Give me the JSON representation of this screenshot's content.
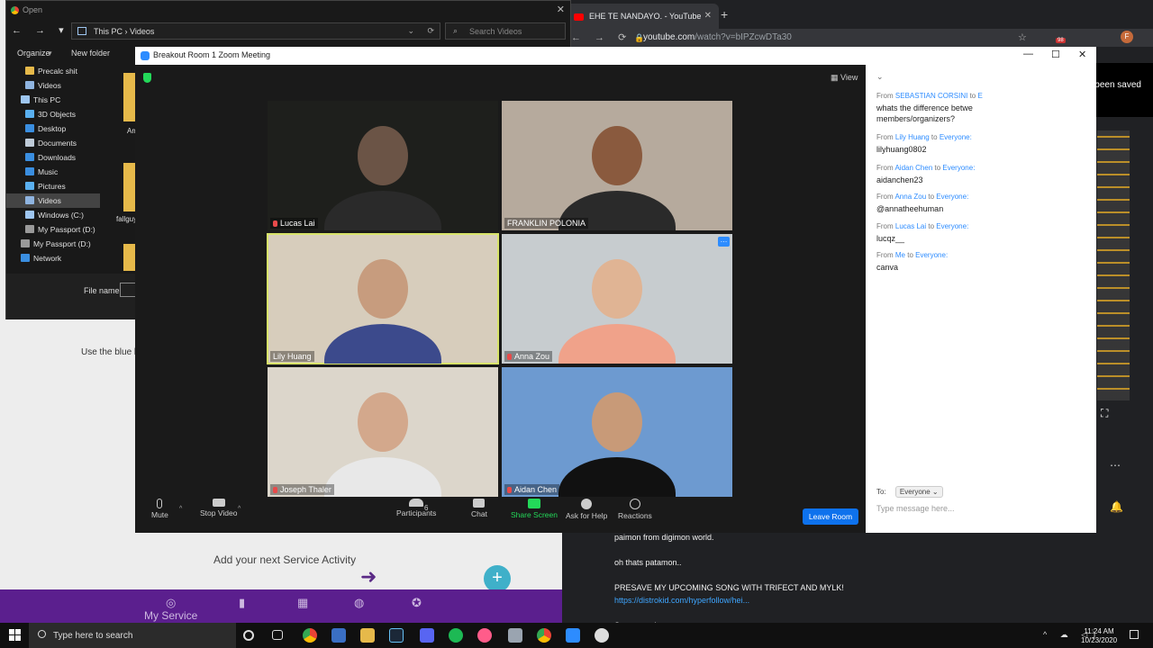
{
  "background_app": {
    "hint_text": "Use the blue b",
    "add_activity": "Add your next Service Activity",
    "nav": [
      {
        "icon": "fingerprint-icon",
        "label": "My Service"
      },
      {
        "icon": "chart-icon",
        "label": ""
      },
      {
        "icon": "calendar-icon",
        "label": ""
      },
      {
        "icon": "globe-icon",
        "label": ""
      },
      {
        "icon": "star-icon",
        "label": ""
      }
    ],
    "brand_color": "#5b1f8e"
  },
  "chrome": {
    "tab_title": "EHE TE NANDAYO. - YouTube",
    "url_host": "youtube.com",
    "url_path": "/watch?v=bIPZcwDTa30",
    "profile_letter": "F",
    "extension_badge": "98",
    "comments": [
      {
        "text": "paimon from digimon world.",
        "link": false
      },
      {
        "text": "oh thats patamon..",
        "link": false
      },
      {
        "text": "PRESAVE MY UPCOMING SONG WITH TRIFECT AND MYLK!",
        "link": false
      },
      {
        "text": "https://distrokid.com/hyperfollow/hei...",
        "link": true
      },
      {
        "text": "Stream and stores:",
        "link": false
      }
    ]
  },
  "notification": {
    "text": "Screenshot has been saved to Gallery"
  },
  "explorer": {
    "title": "Open",
    "path": [
      "This PC",
      "Videos"
    ],
    "search_placeholder": "Search Videos",
    "organize": "Organize",
    "new_folder": "New folder",
    "tree": [
      {
        "label": "Precalc shit",
        "color": "#e6b94a",
        "selected": false,
        "indent": true
      },
      {
        "label": "Videos",
        "color": "#8fb4e0",
        "selected": false,
        "indent": true
      },
      {
        "label": "This PC",
        "color": "#9ec6f0",
        "selected": false,
        "indent": false
      },
      {
        "label": "3D Objects",
        "color": "#5ab0f0",
        "selected": false,
        "indent": true
      },
      {
        "label": "Desktop",
        "color": "#3a8ee0",
        "selected": false,
        "indent": true
      },
      {
        "label": "Documents",
        "color": "#bfcbd8",
        "selected": false,
        "indent": true
      },
      {
        "label": "Downloads",
        "color": "#3a8ee0",
        "selected": false,
        "indent": true
      },
      {
        "label": "Music",
        "color": "#3a8ee0",
        "selected": false,
        "indent": true
      },
      {
        "label": "Pictures",
        "color": "#5ab0f0",
        "selected": false,
        "indent": true
      },
      {
        "label": "Videos",
        "color": "#8fb4e0",
        "selected": true,
        "indent": true
      },
      {
        "label": "Windows (C:)",
        "color": "#9ec6f0",
        "selected": false,
        "indent": true
      },
      {
        "label": "My Passport (D:)",
        "color": "#9a9a9a",
        "selected": false,
        "indent": true
      },
      {
        "label": "My Passport (D:)",
        "color": "#9a9a9a",
        "selected": false,
        "indent": false
      },
      {
        "label": "Network",
        "color": "#3a8ee0",
        "selected": false,
        "indent": false
      }
    ],
    "files": [
      "Am",
      "fallguy"
    ],
    "filename_label": "File name:"
  },
  "zoom": {
    "window_title": "Breakout Room 1   Zoom Meeting",
    "view_label": "View",
    "participants": [
      {
        "name": "Lucas Lai",
        "bg": "#1e1f1c",
        "face": "#6b5446",
        "muted": true
      },
      {
        "name": "FRANKLIN POLONIA",
        "bg": "#b6aa9d",
        "face": "#8a5a3e",
        "muted": false
      },
      {
        "name": "Lily Huang",
        "bg": "#d7cdbc",
        "face": "#c79c7e",
        "muted": false,
        "active": true
      },
      {
        "name": "Anna Zou",
        "bg": "#c7cccf",
        "face": "#e0b494",
        "muted": true
      },
      {
        "name": "Joseph Thaler",
        "bg": "#dcd6cb",
        "face": "#d3a88c",
        "muted": true
      },
      {
        "name": "Aidan Chen",
        "bg": "#6d9ad0",
        "face": "#c89a78",
        "muted": true
      }
    ],
    "toolbar": {
      "mute": "Mute",
      "stop_video": "Stop Video",
      "participants": "Participants",
      "participant_count": "6",
      "chat": "Chat",
      "share_screen": "Share Screen",
      "ask_help": "Ask for Help",
      "reactions": "Reactions",
      "leave": "Leave Room"
    },
    "chat": {
      "messages": [
        {
          "from": "SEBASTIAN CORSINI",
          "to": "E",
          "text": "whats the difference betwe members/organizers?"
        },
        {
          "from": "Lily Huang",
          "to": "Everyone:",
          "text": "lilyhuang0802"
        },
        {
          "from": "Aidan Chen",
          "to": "Everyone:",
          "text": "aidanchen23"
        },
        {
          "from": "Anna Zou",
          "to": "Everyone:",
          "text": "@annatheehuman"
        },
        {
          "from": "Lucas Lai",
          "to": "Everyone:",
          "text": "lucqz__"
        },
        {
          "from": "Me",
          "to": "Everyone:",
          "text": "canva"
        }
      ],
      "to_label": "To:",
      "recipient": "Everyone",
      "placeholder": "Type message here..."
    }
  },
  "taskbar": {
    "search_placeholder": "Type here to search",
    "time": "11:24 AM",
    "date": "10/23/2020"
  }
}
